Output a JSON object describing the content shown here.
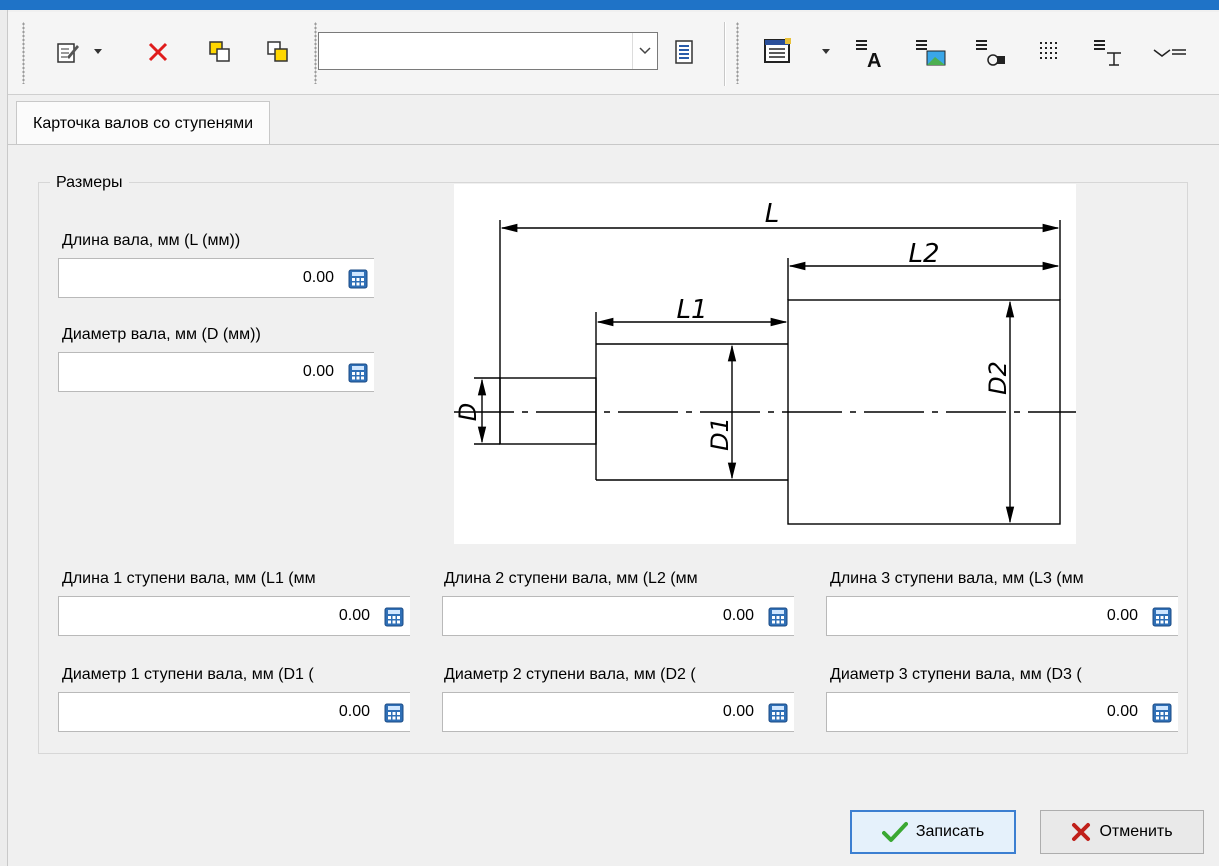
{
  "toolbar": {
    "combo_value": "",
    "icons": [
      "edit-icon",
      "dropdown-arrow-icon",
      "delete-icon",
      "copy-up-icon",
      "copy-down-icon",
      "list-icon",
      "table-view-icon",
      "text-a-icon",
      "picture-icon",
      "shapes-icon",
      "grid-icon",
      "text-format-icon",
      "line-style-icon"
    ]
  },
  "tab": {
    "label": "Карточка валов со ступенями"
  },
  "group": {
    "title": "Размеры"
  },
  "fields": {
    "length": {
      "label": "Длина вала, мм (L (мм))",
      "value": "0.00"
    },
    "diameter": {
      "label": "Диаметр вала, мм (D (мм))",
      "value": "0.00"
    },
    "length1": {
      "label": "Длина 1 ступени вала, мм (L1 (мм",
      "value": "0.00"
    },
    "length2": {
      "label": "Длина 2 ступени вала, мм (L2 (мм",
      "value": "0.00"
    },
    "length3": {
      "label": "Длина 3 ступени вала, мм (L3 (мм",
      "value": "0.00"
    },
    "diameter1": {
      "label": "Диаметр 1 ступени вала, мм (D1 (",
      "value": "0.00"
    },
    "diameter2": {
      "label": "Диаметр 2 ступени вала, мм (D2 (",
      "value": "0.00"
    },
    "diameter3": {
      "label": "Диаметр 3 ступени вала, мм (D3 (",
      "value": "0.00"
    }
  },
  "drawing": {
    "labels": {
      "L": "L",
      "L1": "L1",
      "L2": "L2",
      "D": "D",
      "D1": "D1",
      "D2": "D2"
    }
  },
  "buttons": {
    "save": "Записать",
    "cancel": "Отменить"
  },
  "colors": {
    "accent": "#1f73c7",
    "delete": "#e01c1c",
    "save_check": "#3aa832",
    "cancel_x": "#c0201a",
    "calc": "#2f6fb6"
  }
}
